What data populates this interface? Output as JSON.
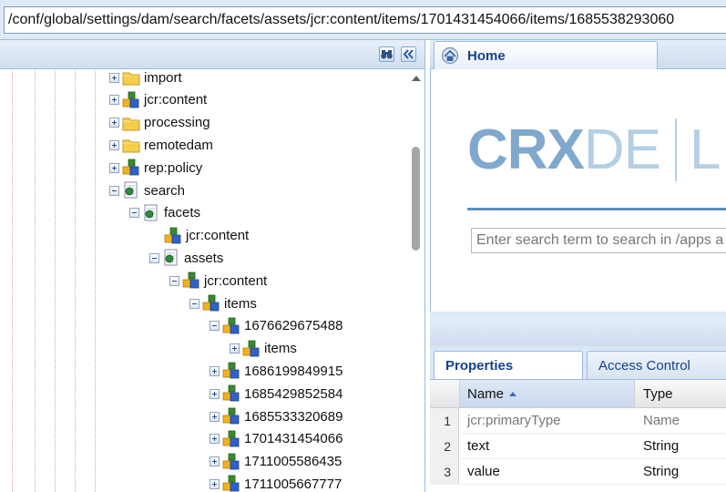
{
  "path_bar": {
    "value": "/conf/global/settings/dam/search/facets/assets/jcr:content/items/1701431454066/items/1685538293060"
  },
  "tree_toolbar": {
    "buttons": [
      {
        "icon": "binoculars-icon"
      },
      {
        "icon": "collapse-left-icon"
      }
    ]
  },
  "tree": {
    "nodes": [
      {
        "label": "import",
        "icon": "folder-icon",
        "expander": "plus"
      },
      {
        "label": "jcr:content",
        "icon": "node-icon",
        "expander": "plus"
      },
      {
        "label": "processing",
        "icon": "folder-icon",
        "expander": "plus"
      },
      {
        "label": "remotedam",
        "icon": "folder-icon",
        "expander": "plus"
      },
      {
        "label": "rep:policy",
        "icon": "node-icon",
        "expander": "plus"
      },
      {
        "label": "search",
        "icon": "page-icon",
        "expander": "minus"
      },
      {
        "label": "facets",
        "icon": "page-icon",
        "expander": "minus"
      },
      {
        "label": "jcr:content",
        "icon": "node-icon",
        "expander": "none"
      },
      {
        "label": "assets",
        "icon": "page-icon",
        "expander": "minus"
      },
      {
        "label": "jcr:content",
        "icon": "node-icon",
        "expander": "minus"
      },
      {
        "label": "items",
        "icon": "node-icon",
        "expander": "minus"
      },
      {
        "label": "1676629675488",
        "icon": "node-icon",
        "expander": "minus"
      },
      {
        "label": "items",
        "icon": "node-icon",
        "expander": "plus"
      },
      {
        "label": "1686199849915",
        "icon": "node-icon",
        "expander": "plus"
      },
      {
        "label": "1685429852584",
        "icon": "node-icon",
        "expander": "plus"
      },
      {
        "label": "1685533320689",
        "icon": "node-icon",
        "expander": "plus"
      },
      {
        "label": "1701431454066",
        "icon": "node-icon",
        "expander": "plus"
      },
      {
        "label": "1711005586435",
        "icon": "node-icon",
        "expander": "plus"
      },
      {
        "label": "1711005667777",
        "icon": "node-icon",
        "expander": "plus"
      }
    ]
  },
  "home_tab": {
    "label": "Home",
    "icon": "home-icon"
  },
  "home": {
    "logo_bold": "CRX",
    "logo_light": "DE",
    "logo_tail": "L",
    "search_placeholder": "Enter search term to search in /apps a"
  },
  "properties_panel": {
    "tabs": [
      "Properties",
      "Access Control"
    ],
    "columns": {
      "name": "Name",
      "type": "Type"
    },
    "rows": [
      {
        "num": "1",
        "name": "jcr:primaryType",
        "type": "Name"
      },
      {
        "num": "2",
        "name": "text",
        "type": "String"
      },
      {
        "num": "3",
        "name": "value",
        "type": "String"
      }
    ]
  },
  "colors": {
    "panel_border": "#99bbe8",
    "panel_bg": "#dfe8f6",
    "tab_text": "#15428b",
    "logo": "#7fa8cc"
  }
}
